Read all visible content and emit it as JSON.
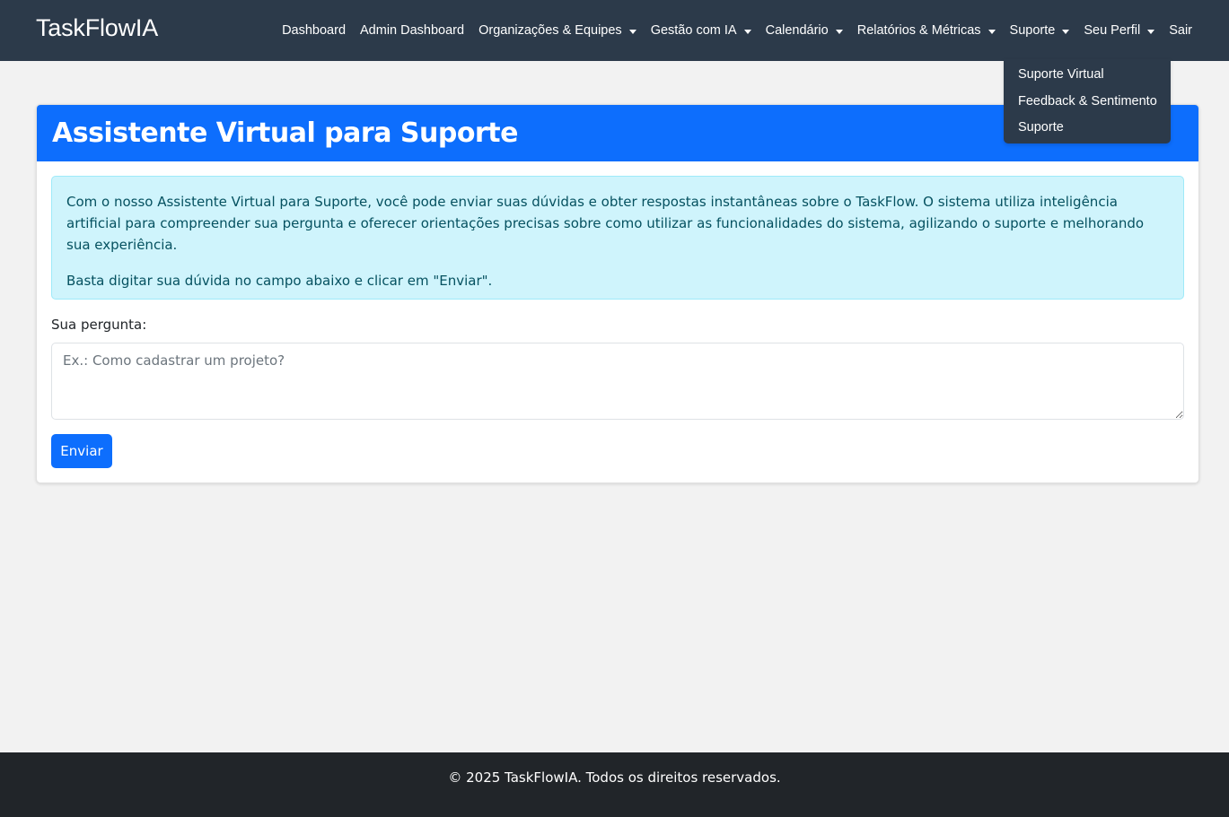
{
  "navbar": {
    "brand": "TaskFlowIA",
    "items": [
      {
        "label": "Dashboard",
        "dropdown": false
      },
      {
        "label": "Admin Dashboard",
        "dropdown": false
      },
      {
        "label": "Organizações & Equipes",
        "dropdown": true
      },
      {
        "label": "Gestão com IA",
        "dropdown": true
      },
      {
        "label": "Calendário",
        "dropdown": true
      },
      {
        "label": "Relatórios & Métricas",
        "dropdown": true
      },
      {
        "label": "Suporte",
        "dropdown": true
      },
      {
        "label": "Seu Perfil",
        "dropdown": true
      },
      {
        "label": "Sair",
        "dropdown": false
      }
    ]
  },
  "dropdown": {
    "items": [
      "Suporte Virtual",
      "Feedback & Sentimento",
      "Suporte"
    ]
  },
  "card": {
    "title": "Assistente Virtual para Suporte",
    "info_paragraph_1": "Com o nosso Assistente Virtual para Suporte, você pode enviar suas dúvidas e obter respostas instantâneas sobre o TaskFlow. O sistema utiliza inteligência artificial para compreender sua pergunta e oferecer orientações precisas sobre como utilizar as funcionalidades do sistema, agilizando o suporte e melhorando sua experiência.",
    "info_paragraph_2": "Basta digitar sua dúvida no campo abaixo e clicar em \"Enviar\".",
    "question_label": "Sua pergunta:",
    "question_placeholder": "Ex.: Como cadastrar um projeto?",
    "question_value": "",
    "submit_label": "Enviar"
  },
  "footer": {
    "text": "© 2025 TaskFlowIA. Todos os direitos reservados."
  },
  "colors": {
    "navbar_bg": "#2c3a4a",
    "primary": "#0d6efd",
    "info_bg": "#cff4fc",
    "info_text": "#055160",
    "footer_bg": "#212529",
    "page_bg": "#f2f2f2"
  }
}
